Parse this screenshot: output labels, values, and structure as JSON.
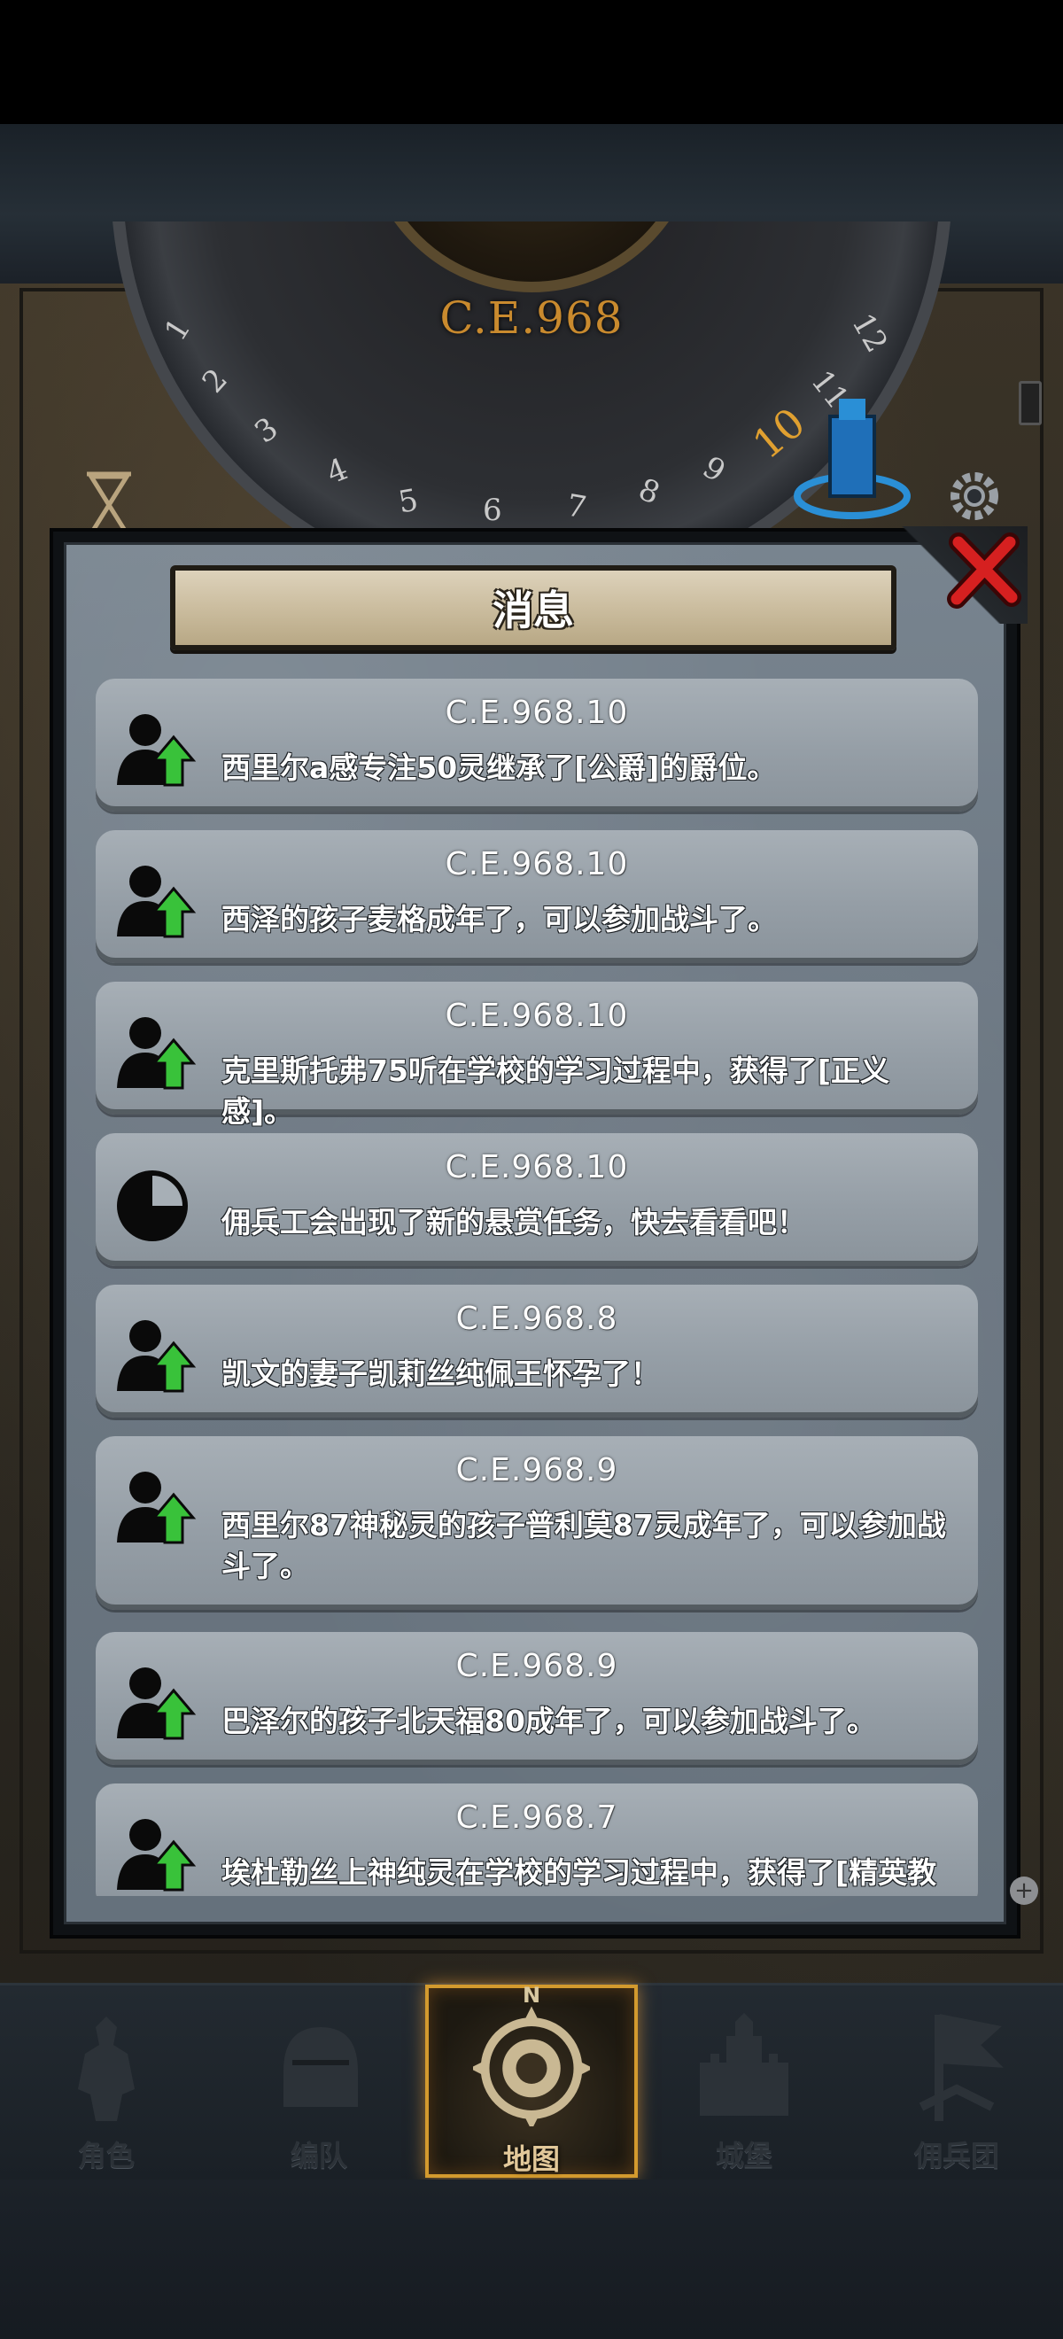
{
  "dial": {
    "year": "C.E.968",
    "months": [
      "1",
      "2",
      "3",
      "4",
      "5",
      "6",
      "7",
      "8",
      "9",
      "10",
      "11",
      "12"
    ],
    "active_month": "10"
  },
  "dialog": {
    "title": "消息",
    "messages": [
      {
        "date": "C.E.968.10",
        "text": "西里尔a感专注50灵继承了[公爵]的爵位。",
        "icon": "person-up-icon"
      },
      {
        "date": "C.E.968.10",
        "text": "西泽的孩子麦格成年了，可以参加战斗了。",
        "icon": "person-up-icon"
      },
      {
        "date": "C.E.968.10",
        "text": "克里斯托弗75听在学校的学习过程中，获得了[正义感]。",
        "icon": "person-up-icon"
      },
      {
        "date": "C.E.968.10",
        "text": "佣兵工会出现了新的悬赏任务，快去看看吧！",
        "icon": "clock-icon"
      },
      {
        "date": "C.E.968.8",
        "text": "凯文的妻子凯莉丝纯佩王怀孕了！",
        "icon": "person-up-icon"
      },
      {
        "date": "C.E.968.9",
        "text": "西里尔87神秘灵的孩子普利莫87灵成年了，可以参加战斗了。",
        "icon": "person-up-icon"
      },
      {
        "date": "C.E.968.9",
        "text": "巴泽尔的孩子北天福80成年了，可以参加战斗了。",
        "icon": "person-up-icon"
      },
      {
        "date": "C.E.968.7",
        "text": "埃杜勒丝上神纯灵在学校的学习过程中，获得了[精英教",
        "icon": "person-up-icon"
      }
    ]
  },
  "nav": {
    "items": [
      {
        "label": "角色",
        "icon": "knight-icon"
      },
      {
        "label": "编队",
        "icon": "helmet-icon"
      },
      {
        "label": "地图",
        "icon": "compass-icon"
      },
      {
        "label": "城堡",
        "icon": "castle-icon"
      },
      {
        "label": "佣兵团",
        "icon": "banner-icon"
      }
    ],
    "active_index": 2,
    "compass_letter": "N"
  },
  "colors": {
    "accent_gold": "#d39a2e",
    "year_orange": "#c98a2e",
    "arrow_green": "#39c23a",
    "close_red": "#d62020"
  }
}
